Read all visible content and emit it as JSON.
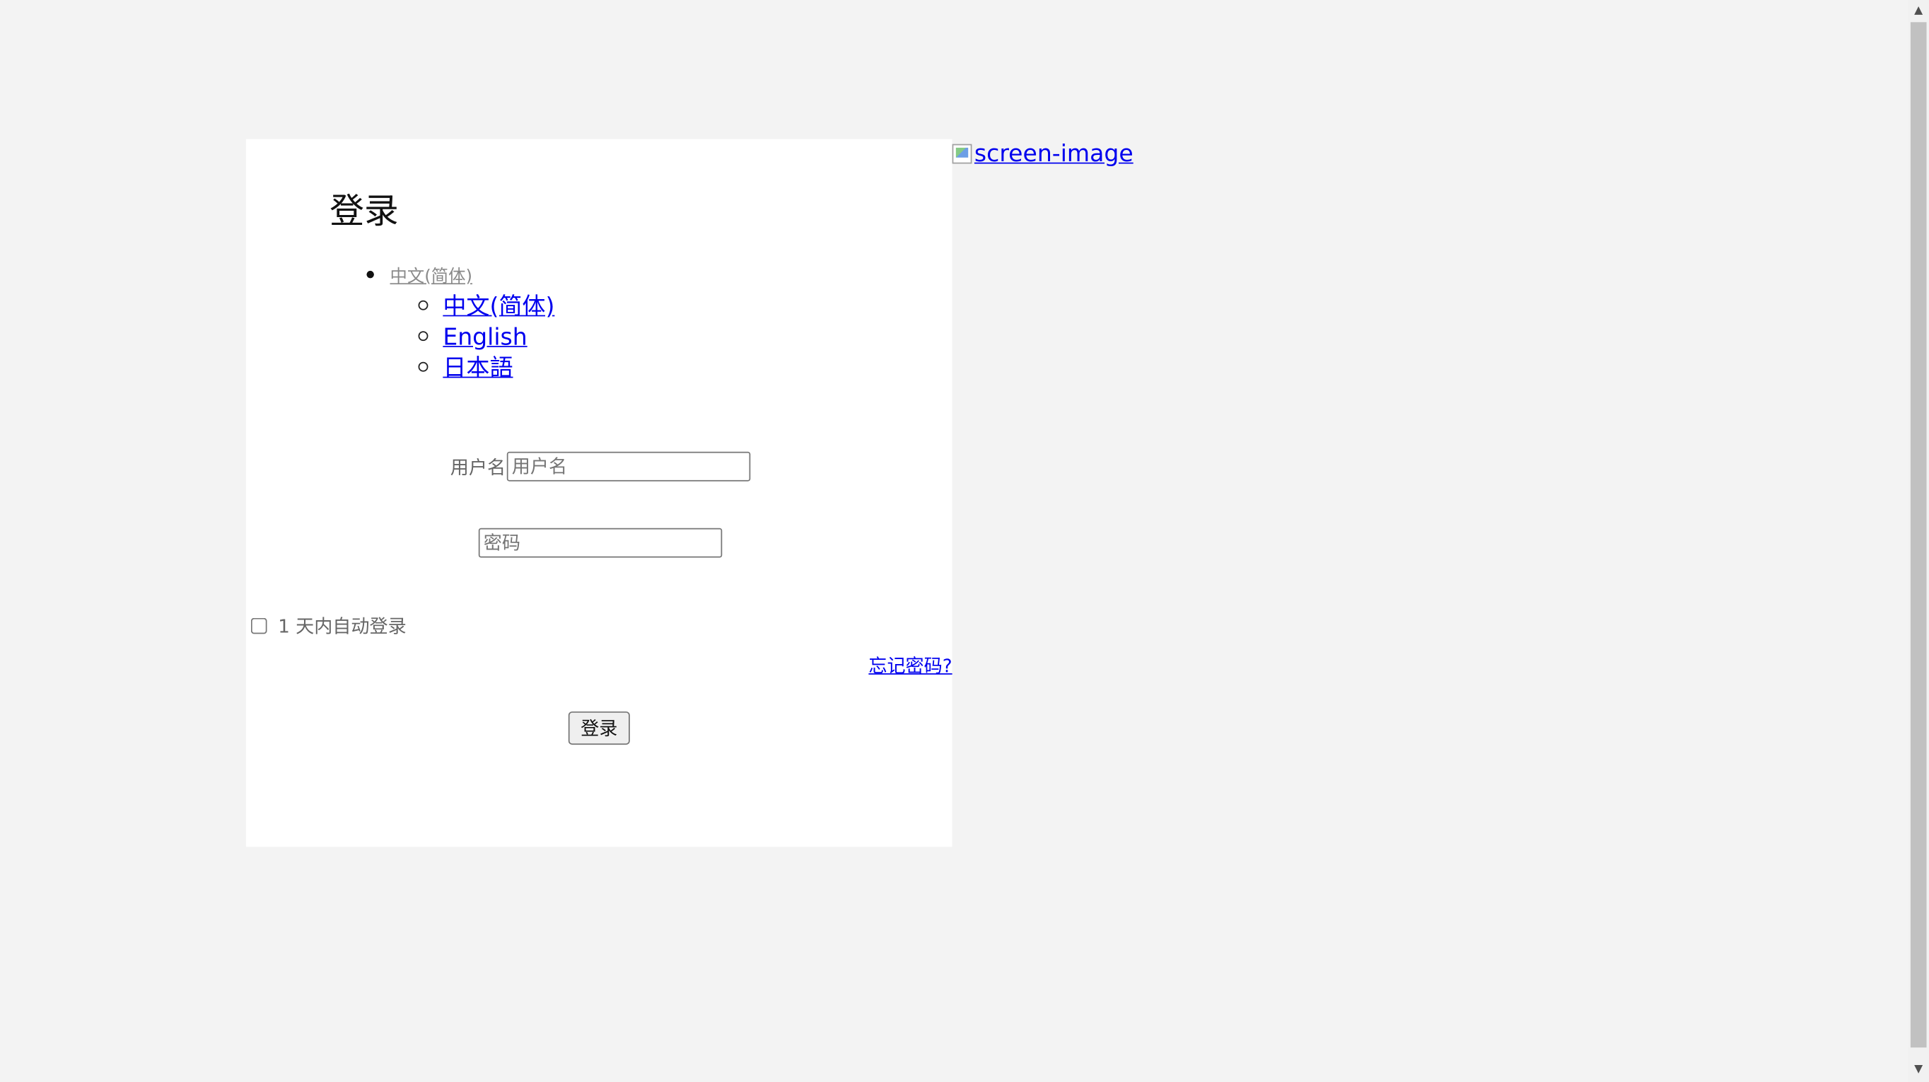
{
  "login": {
    "title": "登录",
    "current_language": "中文(简体)",
    "languages": [
      "中文(简体)",
      "English",
      "日本語"
    ],
    "username_label": "用户名",
    "username_placeholder": "用户名",
    "password_placeholder": "密码",
    "remember_label": "1 天内自动登录",
    "forgot_password": "忘记密码?",
    "submit_label": "登录"
  },
  "aside": {
    "image_alt": "screen-image"
  },
  "scrollbar": {
    "up_icon": "▲",
    "down_icon": "▼"
  }
}
